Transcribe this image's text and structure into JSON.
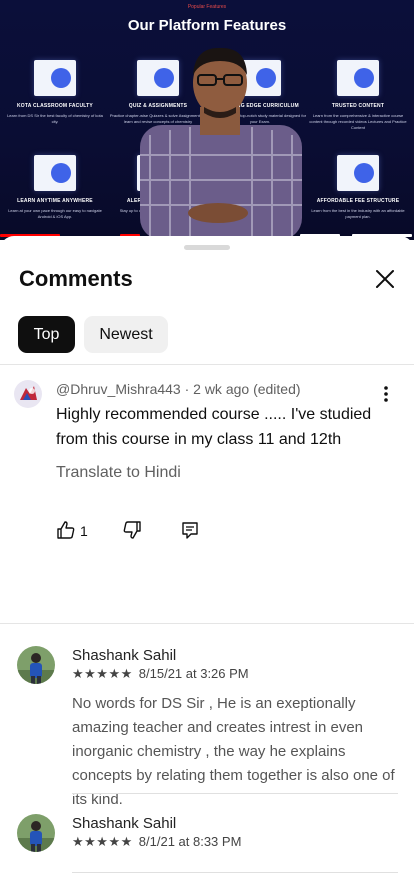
{
  "video": {
    "header_small": "Popular Features",
    "title": "Our Platform Features",
    "features": [
      {
        "name": "KOTA CLASSROOM FACULTY",
        "desc": "Learn from DS Sir the best faculty of chemistry of kota city."
      },
      {
        "name": "QUIZ & ASSIGNMENTS",
        "desc": "Practice chapter-wise Quizzes & solve Assignments to learn and revise concepts of chemistry"
      },
      {
        "name": "CUTTING EDGE CURRICULUM",
        "desc": "Learn with the top-notch study material designed for your Exam."
      },
      {
        "name": "TRUSTED CONTENT",
        "desc": "Learn from the comprehensive & interactive course content through recorded videos Lectures and Practice Content"
      },
      {
        "name": "LEARN ANYTIME ANYWHERE",
        "desc": "Learn at your own pace through our easy to navigate Android & iOS App."
      },
      {
        "name": "ALERT & NOTIFICATION",
        "desc": "Stay up to date with all the course updates."
      },
      {
        "name": "AFFORDABLE FEE STRUCTURE",
        "desc": "Learn from the best in the industry with an affordable payment plan."
      }
    ],
    "progress_colors": [
      "#ff0000",
      "#ffffff"
    ]
  },
  "comments_sheet": {
    "title": "Comments",
    "tabs": [
      {
        "label": "Top",
        "selected": true
      },
      {
        "label": "Newest",
        "selected": false
      }
    ],
    "comment": {
      "author": "@Dhruv_Mishra443",
      "time": "2 wk ago (edited)",
      "meta": "@Dhruv_Mishra443 · 2 wk ago (edited)",
      "text": "Highly recommended course ..... I've studied from this course in my class 11 and 12th",
      "translate": "Translate to Hindi",
      "likes": "1",
      "icons": [
        "thumbs-up-icon",
        "thumbs-down-icon",
        "reply-icon",
        "more-vert-icon"
      ]
    },
    "reviews": [
      {
        "name": "Shashank Sahil",
        "stars": "★★★★★",
        "rating": 5,
        "date": "8/15/21 at 3:26 PM",
        "text": "No words for DS Sir , He is an exeptionally amazing teacher and creates intrest in even inorganic chemistry , the way he explains concepts by relating them together is also one of its kind."
      },
      {
        "name": "Shashank Sahil",
        "stars": "★★★★★",
        "rating": 5,
        "date": "8/1/21 at 8:33 PM",
        "text": ""
      }
    ]
  }
}
